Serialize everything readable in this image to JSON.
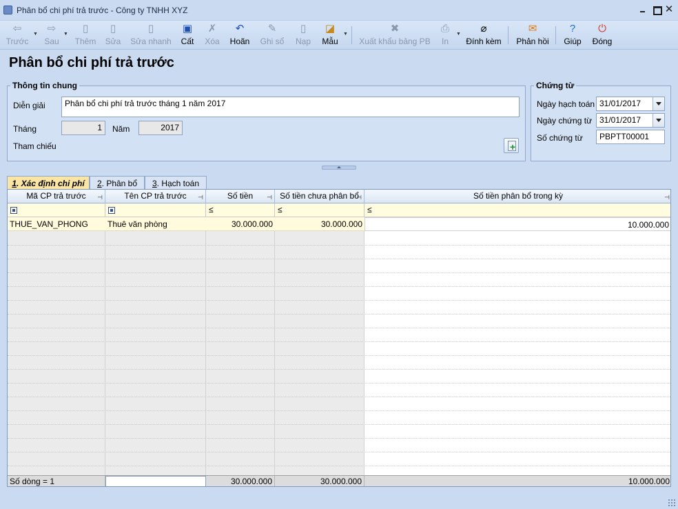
{
  "window": {
    "title": "Phân bổ chi phí trả trước - Công ty TNHH XYZ"
  },
  "toolbar": {
    "prev": "Trước",
    "next": "Sau",
    "add": "Thêm",
    "edit": "Sửa",
    "quick_edit": "Sửa nhanh",
    "save": "Cất",
    "delete": "Xóa",
    "undo": "Hoãn",
    "post": "Ghi sổ",
    "load": "Nạp",
    "template": "Mẫu",
    "export": "Xuất khẩu bảng PB",
    "print": "In",
    "attach": "Đính kèm",
    "feedback": "Phản hồi",
    "help": "Giúp",
    "close": "Đóng"
  },
  "page_title": "Phân bổ chi phí trả trước",
  "general": {
    "legend": "Thông tin chung",
    "description_label": "Diễn giải",
    "description_value": "Phân bổ chi phí trả trước tháng 1 năm 2017",
    "month_label": "Tháng",
    "month_value": "1",
    "year_label": "Năm",
    "year_value": "2017",
    "reference_label": "Tham chiếu"
  },
  "voucher": {
    "legend": "Chứng từ",
    "posting_date_label": "Ngày hạch toán",
    "posting_date_value": "31/01/2017",
    "voucher_date_label": "Ngày chứng từ",
    "voucher_date_value": "31/01/2017",
    "voucher_no_label": "Số chứng từ",
    "voucher_no_value": "PBPTT00001"
  },
  "tabs": [
    {
      "num": "1",
      "label": ". Xác định chi phí"
    },
    {
      "num": "2",
      "label": ". Phân bổ"
    },
    {
      "num": "3",
      "label": ". Hạch toán"
    }
  ],
  "grid": {
    "columns": [
      "Mã CP trả trước",
      "Tên CP trả trước",
      "Số tiền",
      "Số tiền chưa phân bổ",
      "Số tiền phân bổ trong kỳ"
    ],
    "filter_ops": [
      "≤",
      "≤",
      "≤"
    ],
    "rows": [
      {
        "code": "THUE_VAN_PHONG",
        "name": "Thuê văn phòng",
        "amount": "30.000.000",
        "unallocated": "30.000.000",
        "allocated_period": "10.000.000"
      }
    ],
    "footer": {
      "row_count": "Số dòng = 1",
      "amount": "30.000.000",
      "unallocated": "30.000.000",
      "allocated_period": "10.000.000"
    }
  }
}
